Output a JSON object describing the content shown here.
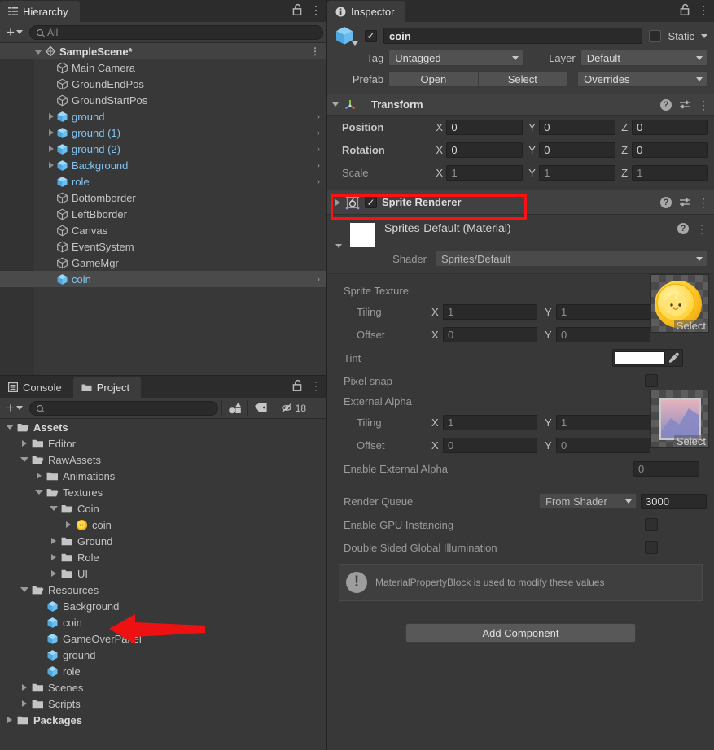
{
  "hierarchy": {
    "tab_label": "Hierarchy",
    "tab_icon": "hierarchy-icon",
    "lock_icon": "lock-icon",
    "menu_icon": "kebab-menu-icon",
    "create_label": "+",
    "search_placeholder": "All",
    "search_value": "",
    "items": [
      {
        "label": "SampleScene*",
        "depth": 0,
        "icon": "scene-icon",
        "expanded": true,
        "prefab": false,
        "selected": false,
        "chevron": false,
        "scene": true
      },
      {
        "label": "Main Camera",
        "depth": 1,
        "icon": "gameobject-icon",
        "expanded": null,
        "prefab": false,
        "selected": false,
        "chevron": false
      },
      {
        "label": "GroundEndPos",
        "depth": 1,
        "icon": "gameobject-icon",
        "expanded": null,
        "prefab": false,
        "selected": false,
        "chevron": false
      },
      {
        "label": "GroundStartPos",
        "depth": 1,
        "icon": "gameobject-icon",
        "expanded": null,
        "prefab": false,
        "selected": false,
        "chevron": false
      },
      {
        "label": "ground",
        "depth": 1,
        "icon": "prefab-icon",
        "expanded": false,
        "prefab": true,
        "selected": false,
        "chevron": true
      },
      {
        "label": "ground (1)",
        "depth": 1,
        "icon": "prefab-icon",
        "expanded": false,
        "prefab": true,
        "selected": false,
        "chevron": true
      },
      {
        "label": "ground (2)",
        "depth": 1,
        "icon": "prefab-icon",
        "expanded": false,
        "prefab": true,
        "selected": false,
        "chevron": true
      },
      {
        "label": "Background",
        "depth": 1,
        "icon": "prefab-icon",
        "expanded": false,
        "prefab": true,
        "selected": false,
        "chevron": true
      },
      {
        "label": "role",
        "depth": 1,
        "icon": "prefab-icon",
        "expanded": null,
        "prefab": true,
        "selected": false,
        "chevron": true
      },
      {
        "label": "Bottomborder",
        "depth": 1,
        "icon": "gameobject-icon",
        "expanded": null,
        "prefab": false,
        "selected": false,
        "chevron": false
      },
      {
        "label": "LeftBborder",
        "depth": 1,
        "icon": "gameobject-icon",
        "expanded": null,
        "prefab": false,
        "selected": false,
        "chevron": false
      },
      {
        "label": "Canvas",
        "depth": 1,
        "icon": "gameobject-icon",
        "expanded": null,
        "prefab": false,
        "selected": false,
        "chevron": false
      },
      {
        "label": "EventSystem",
        "depth": 1,
        "icon": "gameobject-icon",
        "expanded": null,
        "prefab": false,
        "selected": false,
        "chevron": false
      },
      {
        "label": "GameMgr",
        "depth": 1,
        "icon": "gameobject-icon",
        "expanded": null,
        "prefab": false,
        "selected": false,
        "chevron": false
      },
      {
        "label": "coin",
        "depth": 1,
        "icon": "prefab-icon",
        "expanded": null,
        "prefab": true,
        "selected": true,
        "chevron": true
      }
    ]
  },
  "project": {
    "tabs": [
      {
        "label": "Console",
        "icon": "console-icon",
        "active": false
      },
      {
        "label": "Project",
        "icon": "folder-icon",
        "active": true
      }
    ],
    "lock_icon": "lock-icon",
    "menu_icon": "kebab-menu-icon",
    "create_label": "+",
    "search_placeholder": "",
    "search_value": "",
    "filter_type_icon": "filter-by-type-icon",
    "filter_label_icon": "filter-by-label-icon",
    "hidden_icon": "eye-off-icon",
    "hidden_count": "18",
    "items": [
      {
        "label": "Assets",
        "depth": 0,
        "icon": "folder-open-icon",
        "expanded": true,
        "bold": true
      },
      {
        "label": "Editor",
        "depth": 1,
        "icon": "folder-icon",
        "expanded": false,
        "bold": false
      },
      {
        "label": "RawAssets",
        "depth": 1,
        "icon": "folder-open-icon",
        "expanded": true,
        "bold": false
      },
      {
        "label": "Animations",
        "depth": 2,
        "icon": "folder-icon",
        "expanded": false,
        "bold": false
      },
      {
        "label": "Textures",
        "depth": 2,
        "icon": "folder-open-icon",
        "expanded": true,
        "bold": false
      },
      {
        "label": "Coin",
        "depth": 3,
        "icon": "folder-open-icon",
        "expanded": true,
        "bold": false
      },
      {
        "label": "coin",
        "depth": 4,
        "icon": "coin-sprite-icon",
        "expanded": false,
        "bold": false
      },
      {
        "label": "Ground",
        "depth": 3,
        "icon": "folder-icon",
        "expanded": false,
        "bold": false
      },
      {
        "label": "Role",
        "depth": 3,
        "icon": "folder-icon",
        "expanded": false,
        "bold": false
      },
      {
        "label": "UI",
        "depth": 3,
        "icon": "folder-icon",
        "expanded": false,
        "bold": false
      },
      {
        "label": "Resources",
        "depth": 1,
        "icon": "folder-open-icon",
        "expanded": true,
        "bold": false
      },
      {
        "label": "Background",
        "depth": 2,
        "icon": "prefab-icon",
        "expanded": null,
        "bold": false
      },
      {
        "label": "coin",
        "depth": 2,
        "icon": "prefab-icon",
        "expanded": null,
        "bold": false
      },
      {
        "label": "GameOverPanel",
        "depth": 2,
        "icon": "prefab-icon",
        "expanded": null,
        "bold": false
      },
      {
        "label": "ground",
        "depth": 2,
        "icon": "prefab-icon",
        "expanded": null,
        "bold": false
      },
      {
        "label": "role",
        "depth": 2,
        "icon": "prefab-icon",
        "expanded": null,
        "bold": false
      },
      {
        "label": "Scenes",
        "depth": 1,
        "icon": "folder-icon",
        "expanded": false,
        "bold": false
      },
      {
        "label": "Scripts",
        "depth": 1,
        "icon": "folder-icon",
        "expanded": false,
        "bold": false
      },
      {
        "label": "Packages",
        "depth": 0,
        "icon": "folder-icon",
        "expanded": false,
        "bold": true
      }
    ]
  },
  "inspector": {
    "tab_label": "Inspector",
    "tab_icon": "info-icon",
    "lock_icon": "lock-icon",
    "menu_icon": "kebab-menu-icon",
    "object_icon": "prefab-icon",
    "enabled_checked": true,
    "name_value": "coin",
    "static_label": "Static",
    "static_checked": false,
    "tag_label": "Tag",
    "tag_value": "Untagged",
    "layer_label": "Layer",
    "layer_value": "Default",
    "prefab_label": "Prefab",
    "open_label": "Open",
    "select_label": "Select",
    "overrides_label": "Overrides",
    "transform": {
      "title": "Transform",
      "icon": "transform-icon",
      "expanded": true,
      "help_icon": "help-icon",
      "preset_icon": "preset-icon",
      "menu_icon": "kebab-menu-icon",
      "rows": [
        {
          "label": "Position",
          "x": "0",
          "y": "0",
          "z": "0",
          "dim": false
        },
        {
          "label": "Rotation",
          "x": "0",
          "y": "0",
          "z": "0",
          "dim": false
        },
        {
          "label": "Scale",
          "x": "1",
          "y": "1",
          "z": "1",
          "dim": true
        }
      ],
      "axis_labels": [
        "X",
        "Y",
        "Z"
      ]
    },
    "sprite_renderer": {
      "title": "Sprite Renderer",
      "icon": "sprite-renderer-icon",
      "enabled_checked": true,
      "expanded": false,
      "help_icon": "help-icon",
      "preset_icon": "preset-icon",
      "menu_icon": "kebab-menu-icon",
      "highlight_color": "#ff1111"
    },
    "material": {
      "title": "Sprites-Default (Material)",
      "swatch_color": "#ffffff",
      "help_icon": "help-icon",
      "menu_icon": "kebab-menu-icon",
      "shader_label": "Shader",
      "shader_value": "Sprites/Default",
      "sprite_texture_label": "Sprite Texture",
      "sprite_texture_thumb": "coin-texture-thumbnail",
      "sprite_texture_select": "Select",
      "tiling_label": "Tiling",
      "offset_label": "Offset",
      "sprite_tiling_x": "1",
      "sprite_tiling_y": "1",
      "sprite_offset_x": "0",
      "sprite_offset_y": "0",
      "tint_label": "Tint",
      "tint_color": "#ffffff",
      "eyedropper_icon": "eyedropper-icon",
      "pixel_snap_label": "Pixel snap",
      "pixel_snap_checked": false,
      "external_alpha_label": "External Alpha",
      "external_alpha_thumb": "gradient-texture-thumbnail",
      "external_alpha_select": "Select",
      "alpha_tiling_x": "1",
      "alpha_tiling_y": "1",
      "alpha_offset_x": "0",
      "alpha_offset_y": "0",
      "enable_external_alpha_label": "Enable External Alpha",
      "enable_external_alpha_value": "0",
      "render_queue_label": "Render Queue",
      "render_queue_mode": "From Shader",
      "render_queue_value": "3000",
      "gpu_instancing_label": "Enable GPU Instancing",
      "gpu_instancing_checked": false,
      "double_sided_label": "Double Sided Global Illumination",
      "double_sided_checked": false,
      "info_icon": "warning-icon",
      "info_text": "MaterialPropertyBlock is used to modify these values",
      "axis_x": "X",
      "axis_y": "Y"
    },
    "add_component_label": "Add Component"
  },
  "annotations": {
    "arrow_color": "#ee1111",
    "arrow_target": "project-item-coin",
    "highlight_target": "sprite-renderer-component-header"
  }
}
